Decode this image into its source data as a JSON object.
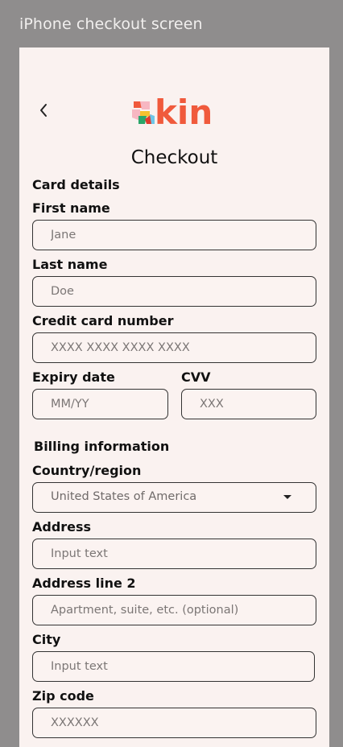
{
  "frame_label": "iPhone checkout screen",
  "header": {
    "back_icon": "chevron-left-icon",
    "logo_text": "kin",
    "title": "Checkout"
  },
  "card": {
    "section_title": "Card details",
    "first_name": {
      "label": "First name",
      "placeholder": "Jane"
    },
    "last_name": {
      "label": "Last name",
      "placeholder": "Doe"
    },
    "card_number": {
      "label": "Credit card number",
      "placeholder": "XXXX XXXX XXXX XXXX"
    },
    "expiry": {
      "label": "Expiry date",
      "placeholder": "MM/YY"
    },
    "cvv": {
      "label": "CVV",
      "placeholder": "XXX"
    }
  },
  "billing": {
    "section_title": "Billing information",
    "country": {
      "label": "Country/region",
      "value": "United States of America",
      "icon": "caret-down-icon"
    },
    "address": {
      "label": "Address",
      "placeholder": "Input text"
    },
    "address2": {
      "label": "Address line 2",
      "placeholder": "Apartment, suite, etc. (optional)"
    },
    "city": {
      "label": "City",
      "placeholder": "Input text"
    },
    "zip": {
      "label": "Zip code",
      "placeholder": "XXXXXX"
    }
  },
  "colors": {
    "background_gray": "#8f8d8d",
    "screen": "#faf2f0",
    "brand_orange": "#f05a3c"
  }
}
